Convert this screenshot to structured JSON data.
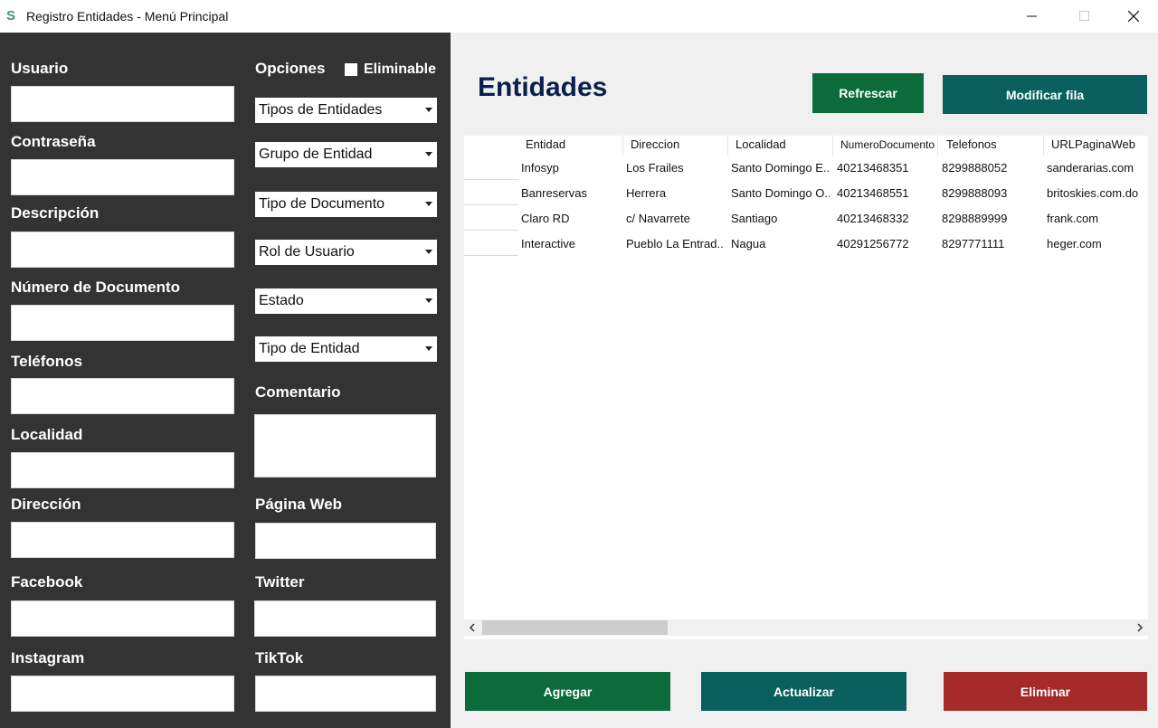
{
  "window": {
    "title": "Registro Entidades - Menú Principal",
    "icon": "S"
  },
  "form": {
    "labels": {
      "usuario": "Usuario",
      "contrasena": "Contraseña",
      "descripcion": "Descripción",
      "numero_documento": "Número de Documento",
      "telefonos": "Teléfonos",
      "localidad": "Localidad",
      "direccion": "Dirección",
      "facebook": "Facebook",
      "instagram": "Instagram",
      "opciones": "Opciones",
      "eliminable": "Eliminable",
      "comentario": "Comentario",
      "pagina_web": "Página Web",
      "twitter": "Twitter",
      "tiktok": "TikTok"
    },
    "selects": {
      "tipos_entidades": "Tipos de Entidades",
      "grupo_entidad": "Grupo de Entidad",
      "tipo_documento": "Tipo de Documento",
      "rol_usuario": "Rol de Usuario",
      "estado": "Estado",
      "tipo_entidad": "Tipo de Entidad"
    },
    "eliminable_checked": false
  },
  "main": {
    "title": "Entidades",
    "buttons": {
      "refrescar": "Refrescar",
      "modificar": "Modificar fila",
      "agregar": "Agregar",
      "actualizar": "Actualizar",
      "eliminar": "Eliminar"
    },
    "colors": {
      "green": "#0b6b3a",
      "teal": "#0a5f5f",
      "red": "#a52a2a"
    }
  },
  "table": {
    "columns": [
      "Entidad",
      "Direccion",
      "Localidad",
      "NumeroDocumento",
      "Telefonos",
      "URLPaginaWeb"
    ],
    "rows": [
      [
        "Infosyp",
        "Los Frailes",
        "Santo Domingo E...",
        "40213468351",
        "8299888052",
        "sanderarias.com"
      ],
      [
        "Banreservas",
        "Herrera",
        "Santo Domingo O...",
        "40213468551",
        "8299888093",
        "britoskies.com.do"
      ],
      [
        "Claro RD",
        "c/ Navarrete",
        "Santiago",
        "40213468332",
        "8298889999",
        "frank.com"
      ],
      [
        "Interactive",
        "Pueblo La Entrad...",
        "Nagua",
        "40291256772",
        "8297771111",
        "heger.com"
      ]
    ]
  }
}
